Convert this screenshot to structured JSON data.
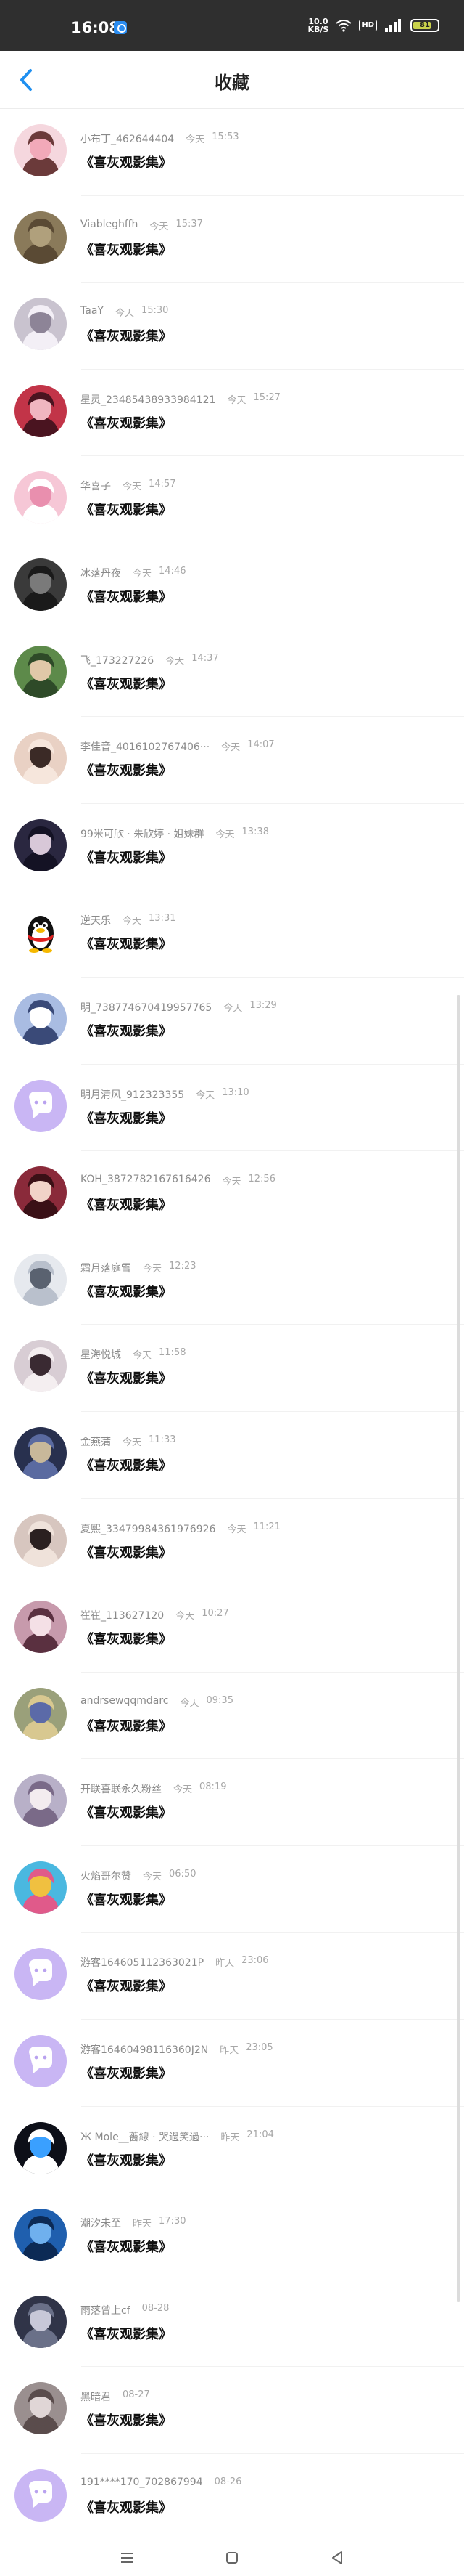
{
  "status_bar": {
    "time": "16:08",
    "net_speed_top": "10.0",
    "net_speed_bottom": "KB/S",
    "hd_label": "HD",
    "battery_level": "81"
  },
  "header": {
    "title": "收藏"
  },
  "favorites": [
    {
      "username": "小布丁_462644404",
      "date": "今天",
      "time": "15:53",
      "album": "《喜灰观影集》",
      "avatar": "anime-pink"
    },
    {
      "username": "Viableghffh",
      "date": "今天",
      "time": "15:37",
      "album": "《喜灰观影集》",
      "avatar": "brown-blur"
    },
    {
      "username": "TaaY",
      "date": "今天",
      "time": "15:30",
      "album": "《喜灰观影集》",
      "avatar": "anime-grey"
    },
    {
      "username": "星灵_23485438933984121",
      "date": "今天",
      "time": "15:27",
      "album": "《喜灰观影集》",
      "avatar": "anime-red"
    },
    {
      "username": "华喜子",
      "date": "今天",
      "time": "14:57",
      "album": "《喜灰观影集》",
      "avatar": "anime-pink2"
    },
    {
      "username": "冰落丹夜",
      "date": "今天",
      "time": "14:46",
      "album": "《喜灰观影集》",
      "avatar": "dark-portrait"
    },
    {
      "username": "飞_173227226",
      "date": "今天",
      "time": "14:37",
      "album": "《喜灰观影集》",
      "avatar": "green-photo"
    },
    {
      "username": "李佳音_4016102767406···",
      "date": "今天",
      "time": "14:07",
      "album": "《喜灰观影集》",
      "avatar": "girl-photo"
    },
    {
      "username": "99米可欣 · 朱欣婷 · 姐妹群",
      "date": "今天",
      "time": "13:38",
      "album": "《喜灰观影集》",
      "avatar": "dark-girl"
    },
    {
      "username": "逆天乐",
      "date": "今天",
      "time": "13:31",
      "album": "《喜灰观影集》",
      "avatar": "qq-penguin"
    },
    {
      "username": "明_738774670419957765",
      "date": "今天",
      "time": "13:29",
      "album": "《喜灰观影集》",
      "avatar": "anime-blue"
    },
    {
      "username": "明月清风_912323355",
      "date": "今天",
      "time": "13:10",
      "album": "《喜灰观影集》",
      "avatar": "default-chat"
    },
    {
      "username": "KOH_3872782167616426",
      "date": "今天",
      "time": "12:56",
      "album": "《喜灰观影集》",
      "avatar": "anime-red2"
    },
    {
      "username": "霜月落庭雪",
      "date": "今天",
      "time": "12:23",
      "album": "《喜灰观影集》",
      "avatar": "anime-bw"
    },
    {
      "username": "星海悦城",
      "date": "今天",
      "time": "11:58",
      "album": "《喜灰观影集》",
      "avatar": "anime-girl-pale"
    },
    {
      "username": "金燕蒲",
      "date": "今天",
      "time": "11:33",
      "album": "《喜灰观影集》",
      "avatar": "anime-dark-blue"
    },
    {
      "username": "夏熙_33479984361976926",
      "date": "今天",
      "time": "11:21",
      "album": "《喜灰观影集》",
      "avatar": "girl-photo2"
    },
    {
      "username": "崔崔_113627120",
      "date": "今天",
      "time": "10:27",
      "album": "《喜灰观影集》",
      "avatar": "anime-rose"
    },
    {
      "username": "andrsewqqmdarc",
      "date": "今天",
      "time": "09:35",
      "album": "《喜灰观影集》",
      "avatar": "pixel-scene"
    },
    {
      "username": "开联喜联永久粉丝",
      "date": "今天",
      "time": "08:19",
      "album": "《喜灰观影集》",
      "avatar": "anime-light"
    },
    {
      "username": "火焰哥尔赞",
      "date": "今天",
      "time": "06:50",
      "album": "《喜灰观影集》",
      "avatar": "colorful-flower"
    },
    {
      "username": "游客16460511236302​1P",
      "date": "昨天",
      "time": "23:06",
      "album": "《喜灰观影集》",
      "avatar": "default-chat"
    },
    {
      "username": "游客16460498116360J2N",
      "date": "昨天",
      "time": "23:05",
      "album": "《喜灰观影集》",
      "avatar": "default-chat"
    },
    {
      "username": "Ж Mole__薔線 · 哭過笑過···",
      "date": "昨天",
      "time": "21:04",
      "album": "《喜灰观影集》",
      "avatar": "black-blue"
    },
    {
      "username": "潮汐未至",
      "date": "昨天",
      "time": "17:30",
      "album": "《喜灰观影集》",
      "avatar": "blue-galaxy"
    },
    {
      "username": "雨落曾上cf",
      "date": "08-28",
      "time": "",
      "album": "《喜灰观影集》",
      "avatar": "dark-anime2"
    },
    {
      "username": "黑暗君",
      "date": "08-27",
      "time": "",
      "album": "《喜灰观影集》",
      "avatar": "grey-portrait"
    },
    {
      "username": "191****170_702867994",
      "date": "08-26",
      "time": "",
      "album": "《喜灰观影集》",
      "avatar": "default-chat"
    }
  ],
  "avatar_palettes": {
    "anime-pink": [
      "#f5d7de",
      "#f2a9b9",
      "#6b3a3a"
    ],
    "brown-blur": [
      "#8a7a5a",
      "#b0a07c",
      "#5a4a34"
    ],
    "anime-grey": [
      "#c9c3cf",
      "#8d8497",
      "#f3eff6"
    ],
    "anime-red": [
      "#c23448",
      "#f0b6c0",
      "#4a1420"
    ],
    "anime-pink2": [
      "#f6c7d6",
      "#e98fae",
      "#ffffff"
    ],
    "dark-portrait": [
      "#3a3a3a",
      "#7a7a7a",
      "#1a1a1a"
    ],
    "green-photo": [
      "#5d8a4a",
      "#e0c8a8",
      "#2e4a28"
    ],
    "girl-photo": [
      "#e9d1c4",
      "#3b2a26",
      "#f6e6dc"
    ],
    "dark-girl": [
      "#2a2740",
      "#d8c8d8",
      "#141224"
    ],
    "anime-blue": [
      "#a9bce2",
      "#ffffff",
      "#3a4a78"
    ],
    "default-chat": [
      "#c9b6f4",
      "#ffffff",
      "#b9a2ef"
    ],
    "anime-red2": [
      "#8a2a3a",
      "#f1d3c8",
      "#3a1016"
    ],
    "anime-bw": [
      "#e6e9ee",
      "#5a6270",
      "#b9c0cc"
    ],
    "anime-girl-pale": [
      "#d8cdd4",
      "#3a2a32",
      "#f4eef0"
    ],
    "anime-dark-blue": [
      "#28304e",
      "#c8b89a",
      "#5a6aa0"
    ],
    "girl-photo2": [
      "#d7c6bf",
      "#2a2020",
      "#efe2da"
    ],
    "anime-rose": [
      "#c79aac",
      "#f4e0e6",
      "#5a3040"
    ],
    "pixel-scene": [
      "#9aa07a",
      "#5b6aa8",
      "#d8c890"
    ],
    "anime-light": [
      "#b8b0c8",
      "#f3ecef",
      "#7a6a88"
    ],
    "colorful-flower": [
      "#4ab8e0",
      "#f0c040",
      "#e05a8a"
    ],
    "black-blue": [
      "#0d0f18",
      "#3aa0ff",
      "#ffffff"
    ],
    "blue-galaxy": [
      "#1f5fae",
      "#6fb0ee",
      "#0c2a55"
    ],
    "dark-anime2": [
      "#303448",
      "#c8c8d8",
      "#6a7088"
    ],
    "grey-portrait": [
      "#9a8f8f",
      "#e0d6d6",
      "#5a4c4c"
    ],
    "qq-penguin": [
      "#ffffff",
      "#111111",
      "#f5b800"
    ]
  },
  "accent_color": "#1e8ff0",
  "icons": {
    "back": "chevron-left-icon",
    "nav_menu": "menu-icon",
    "nav_home": "square-icon",
    "nav_back": "triangle-back-icon"
  }
}
